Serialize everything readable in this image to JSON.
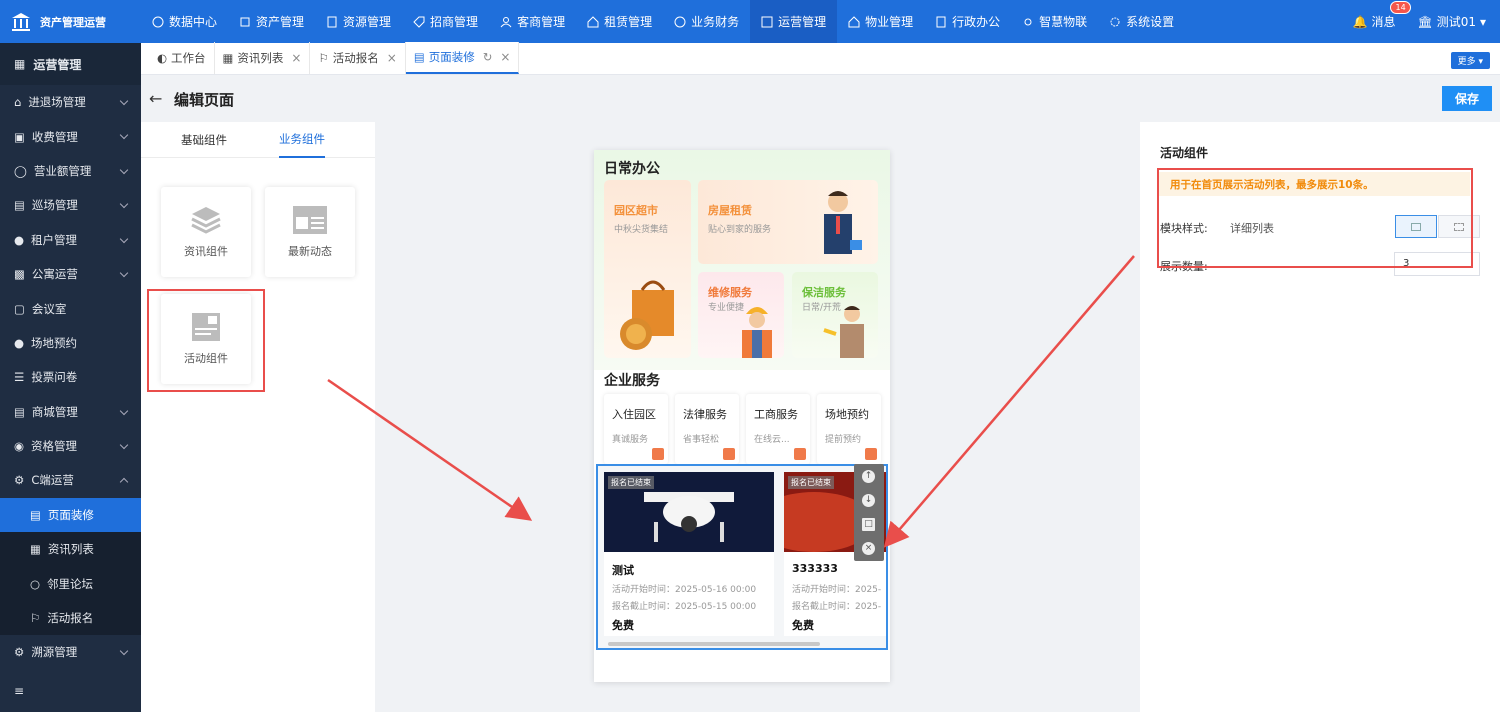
{
  "app": {
    "title": "资产管理运营"
  },
  "nav": {
    "items": [
      {
        "label": "数据中心"
      },
      {
        "label": "资产管理"
      },
      {
        "label": "资源管理"
      },
      {
        "label": "招商管理"
      },
      {
        "label": "客商管理"
      },
      {
        "label": "租赁管理"
      },
      {
        "label": "业务财务"
      },
      {
        "label": "运营管理"
      },
      {
        "label": "物业管理"
      },
      {
        "label": "行政办公"
      },
      {
        "label": "智慧物联"
      },
      {
        "label": "系统设置"
      }
    ]
  },
  "header": {
    "msg_label": "消息",
    "msg_count": "14",
    "user": "测试01"
  },
  "sidebar": {
    "title": "运营管理",
    "items": [
      {
        "label": "进退场管理"
      },
      {
        "label": "收费管理"
      },
      {
        "label": "营业额管理"
      },
      {
        "label": "巡场管理"
      },
      {
        "label": "租户管理"
      },
      {
        "label": "公寓运营"
      },
      {
        "label": "会议室"
      },
      {
        "label": "场地预约"
      },
      {
        "label": "投票问卷"
      },
      {
        "label": "商城管理"
      },
      {
        "label": "资格管理"
      },
      {
        "label": "C端运营"
      }
    ],
    "subitems": [
      {
        "label": "页面装修"
      },
      {
        "label": "资讯列表"
      },
      {
        "label": "邻里论坛"
      },
      {
        "label": "活动报名"
      }
    ],
    "last": {
      "label": "溯源管理"
    }
  },
  "tabs": [
    {
      "label": "工作台"
    },
    {
      "label": "资讯列表"
    },
    {
      "label": "活动报名"
    },
    {
      "label": "页面装修"
    }
  ],
  "tabbar": {
    "more": "更多"
  },
  "page": {
    "title": "编辑页面",
    "save": "保存"
  },
  "left": {
    "tabs": [
      {
        "label": "基础组件"
      },
      {
        "label": "业务组件"
      }
    ],
    "cards": [
      {
        "label": "资讯组件"
      },
      {
        "label": "最新动态"
      },
      {
        "label": "活动组件"
      }
    ]
  },
  "preview": {
    "daily_title": "日常办公",
    "services": [
      {
        "title": "园区超市",
        "sub": "中秋尖货集结"
      },
      {
        "title": "房屋租赁",
        "sub": "贴心到家的服务"
      },
      {
        "title": "维修服务",
        "sub": "专业便捷"
      },
      {
        "title": "保洁服务",
        "sub": "日常/开荒"
      }
    ],
    "enterprise_title": "企业服务",
    "enterprise": [
      {
        "title": "入住园区",
        "sub": "真诚服务"
      },
      {
        "title": "法律服务",
        "sub": "省事轻松"
      },
      {
        "title": "工商服务",
        "sub": "在线云..."
      },
      {
        "title": "场地预约",
        "sub": "提前预约"
      }
    ],
    "activities": [
      {
        "tag": "报名已结束",
        "name": "测试",
        "start": "活动开始时间：2025-05-16 00:00",
        "end": "报名截止时间：2025-05-15 00:00",
        "price": "免费"
      },
      {
        "tag": "报名已结束",
        "name": "333333",
        "start": "活动开始时间：2025-",
        "end": "报名截止时间：2025-",
        "price": "免费"
      }
    ]
  },
  "right": {
    "title": "活动组件",
    "tip": "用于在首页展示活动列表，最多展示10条。",
    "style_label": "模块样式:",
    "style_value": "详细列表",
    "count_label": "展示数量:",
    "count_value": "3"
  },
  "colors": {
    "primary": "#1f6fdb",
    "sidebar": "#1f2d42",
    "annotation": "#e94e4b",
    "tip": "#f18b0c"
  }
}
